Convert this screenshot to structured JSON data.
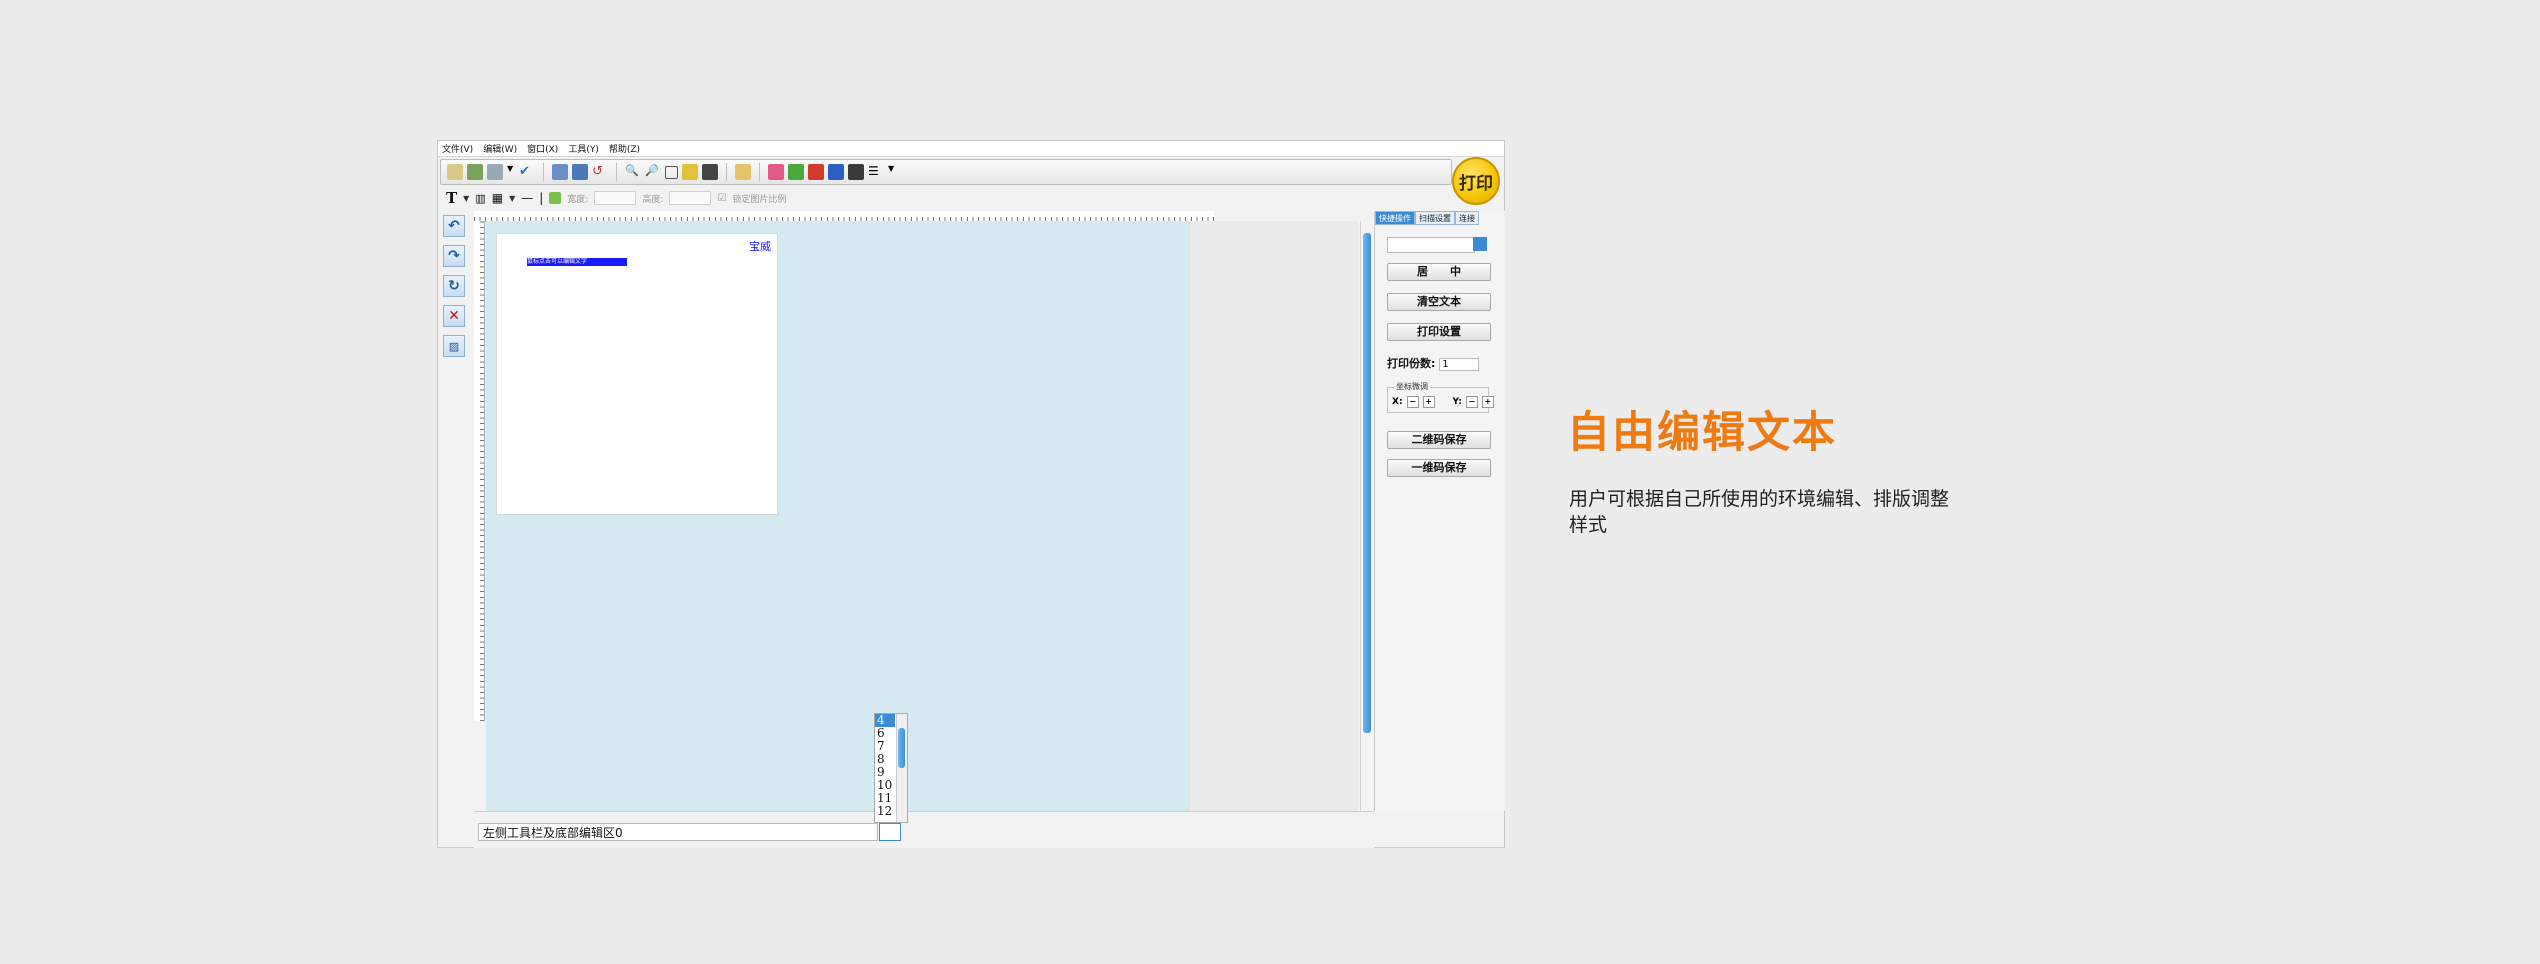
{
  "menu": [
    "文件(V)",
    "编辑(W)",
    "窗口(X)",
    "工具(Y)",
    "帮助(Z)"
  ],
  "toolbar2": {
    "width_label": "宽度:",
    "height_label": "高度:",
    "lock_ratio_label": "锁定图片比例"
  },
  "print_button": "打印",
  "left_tools": [
    "undo-icon",
    "redo-icon",
    "refresh-icon",
    "delete-icon",
    "image-icon"
  ],
  "ruler_labels": [
    "0",
    "1",
    "2",
    "3",
    "4",
    "5",
    "6",
    "7",
    "8",
    "9",
    "10",
    "11"
  ],
  "label": {
    "corner_text": "宝威",
    "bar_text": "鼠标点击可以编辑文字"
  },
  "side_panel": {
    "tabs": [
      "快捷操作",
      "扫描设置",
      "连接"
    ],
    "center_button": "居　　中",
    "clear_button": "清空文本",
    "print_settings_button": "打印设置",
    "copies_label": "打印份数:",
    "copies_value": "1",
    "fine_tune_title": "坐标微调",
    "x_label": "X:",
    "y_label": "Y:",
    "qr_save_button": "二维码保存",
    "barcode_save_button": "一维码保存"
  },
  "bottom_edit": {
    "text": "左侧工具栏及底部编辑区0",
    "font_size_selected": "4",
    "font_size_options": [
      "4",
      "6",
      "7",
      "8",
      "9",
      "10",
      "11",
      "12"
    ]
  },
  "promo": {
    "title": "自由编辑文本",
    "description": "用户可根据自己所使用的环境编辑、排版调整样式"
  },
  "colors": {
    "accent_orange": "#f07a12",
    "canvas_blue": "#d5e9f1",
    "selection_blue": "#3a8ad6",
    "print_yellow": "#f5c400"
  }
}
